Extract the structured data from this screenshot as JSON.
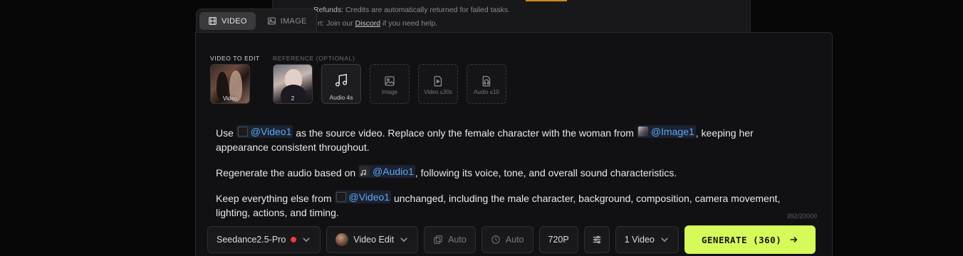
{
  "background_notice": {
    "refunds_label": "Refunds:",
    "refunds_text": "Credits are automatically returned for failed tasks.",
    "support_prefix": "rt: Join our",
    "support_link": "Discord",
    "support_suffix": "if you need help."
  },
  "tabs": [
    {
      "label": "VIDEO",
      "icon": "film-icon",
      "active": true
    },
    {
      "label": "IMAGE",
      "icon": "image-icon",
      "active": false
    }
  ],
  "inputs": {
    "video_label": "VIDEO TO EDIT",
    "reference_label": "REFERENCE (OPTIONAL)",
    "video_thumb_caption": "Video",
    "image_thumb_caption": "2",
    "audio_thumb_caption": "Audio 4s",
    "slots": [
      {
        "label": "Image",
        "icon": "image-icon"
      },
      {
        "label": "Video ≤30s",
        "icon": "video-file-icon"
      },
      {
        "label": "Audio ≤10",
        "icon": "audio-file-icon"
      }
    ]
  },
  "prompt": {
    "p1": {
      "t1": "Use",
      "m1": "@Video1",
      "t2": "as the source video. Replace only the female character with the woman from",
      "m2": "@Image1",
      "t3": ", keeping her appearance consistent throughout."
    },
    "p2": {
      "t1": "Regenerate the audio based on",
      "m1": "@Audio1",
      "t2": ", following its voice, tone, and overall sound characteristics."
    },
    "p3": {
      "t1": "Keep everything else from",
      "m1": "@Video1",
      "t2": "unchanged, including the male character, background, composition, camera movement, lighting, actions, and timing."
    }
  },
  "char_counter": "392/20000",
  "toolbar": {
    "model": "Seedance2.5-Pro",
    "mode": "Video Edit",
    "ratio": "Auto",
    "duration": "Auto",
    "resolution": "720P",
    "count": "1 Video",
    "generate": "GENERATE (360)"
  },
  "colors": {
    "accent": "#d6fa5a",
    "mention": "#5ea6f2",
    "status_dot": "#ef3b3b"
  }
}
